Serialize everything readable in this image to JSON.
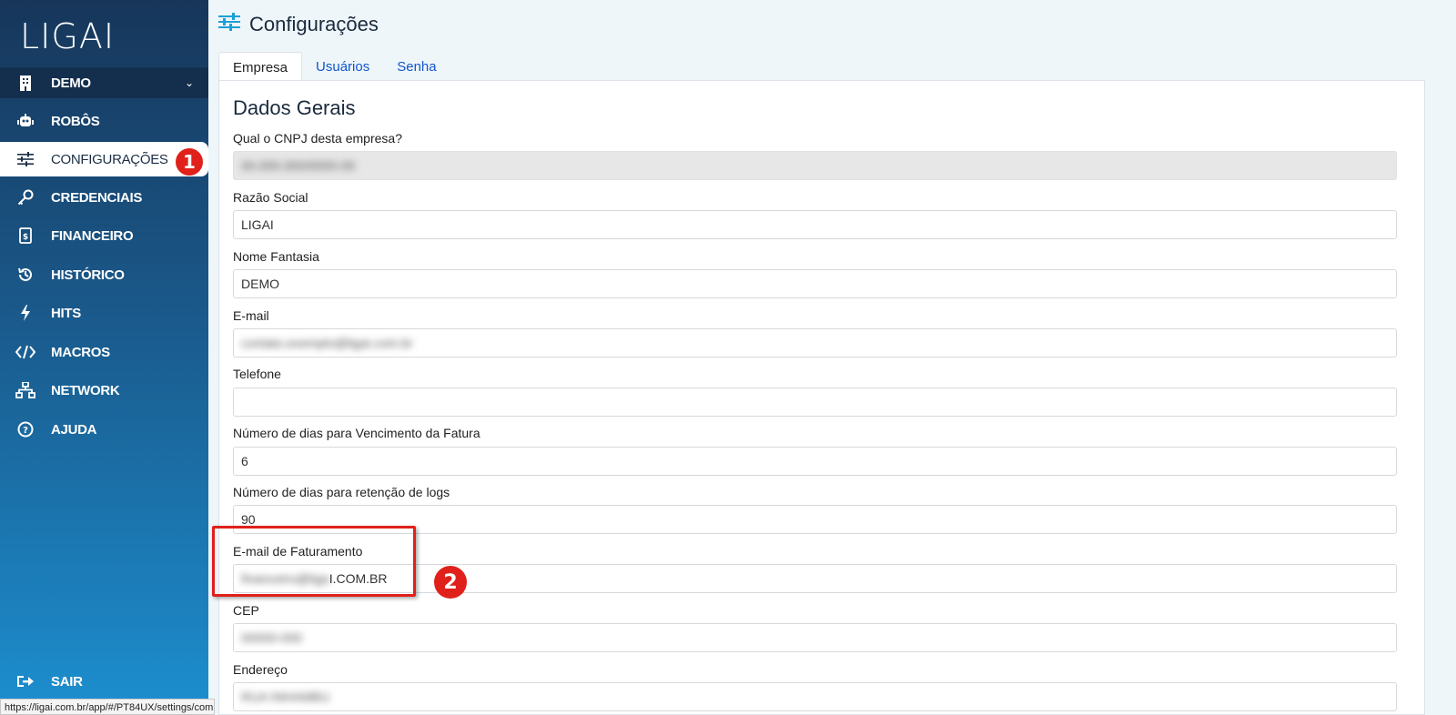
{
  "app": {
    "logo": "LIGAI"
  },
  "sidebar": {
    "company": {
      "icon": "building-icon",
      "label": "DEMO"
    },
    "items": [
      {
        "icon": "robot-icon",
        "label": "ROBÔS"
      },
      {
        "icon": "sliders-icon",
        "label": "CONFIGURAÇÕES",
        "active": true
      },
      {
        "icon": "key-icon",
        "label": "CREDENCIAIS"
      },
      {
        "icon": "invoice-icon",
        "label": "FINANCEIRO"
      },
      {
        "icon": "history-icon",
        "label": "HISTÓRICO"
      },
      {
        "icon": "lightning-icon",
        "label": "HITS"
      },
      {
        "icon": "code-icon",
        "label": "MACROS"
      },
      {
        "icon": "network-icon",
        "label": "NETWORK"
      },
      {
        "icon": "help-icon",
        "label": "AJUDA"
      }
    ],
    "logout": {
      "icon": "logout-icon",
      "label": "SAIR"
    }
  },
  "status_url": "https://ligai.com.br/app/#/PT84UX/settings/company",
  "page": {
    "title": "Configurações",
    "title_icon": "sliders-icon"
  },
  "tabs": [
    {
      "label": "Empresa",
      "active": true
    },
    {
      "label": "Usuários"
    },
    {
      "label": "Senha"
    }
  ],
  "section_title": "Dados Gerais",
  "fields": {
    "cnpj": {
      "label": "Qual o CNPJ desta empresa?",
      "value": "00.000.000/0000-00",
      "disabled": true
    },
    "razao": {
      "label": "Razão Social",
      "value": "LIGAI"
    },
    "fantasia": {
      "label": "Nome Fantasia",
      "value": "DEMO"
    },
    "email": {
      "label": "E-mail",
      "value": "contato.exemplo@ligai.com.br"
    },
    "telefone": {
      "label": "Telefone",
      "value": ""
    },
    "dias_venc": {
      "label": "Número de dias para Vencimento da Fatura",
      "value": "6"
    },
    "dias_logs": {
      "label": "Número de dias para retenção de logs",
      "value": "90"
    },
    "email_fat": {
      "label": "E-mail de Faturamento",
      "value_blur": "financeiro@liga",
      "value_tail": "I.COM.BR"
    },
    "cep": {
      "label": "CEP",
      "value": "00000-000"
    },
    "endereco": {
      "label": "Endereço",
      "value": "RUA INHAMBU"
    }
  },
  "annotations": {
    "step1": "1",
    "step2": "2"
  },
  "colors": {
    "accent": "#1aa0d8",
    "badge": "#e0201a",
    "sidebar_top": "#17365a",
    "sidebar_bottom": "#1c8fcf"
  }
}
